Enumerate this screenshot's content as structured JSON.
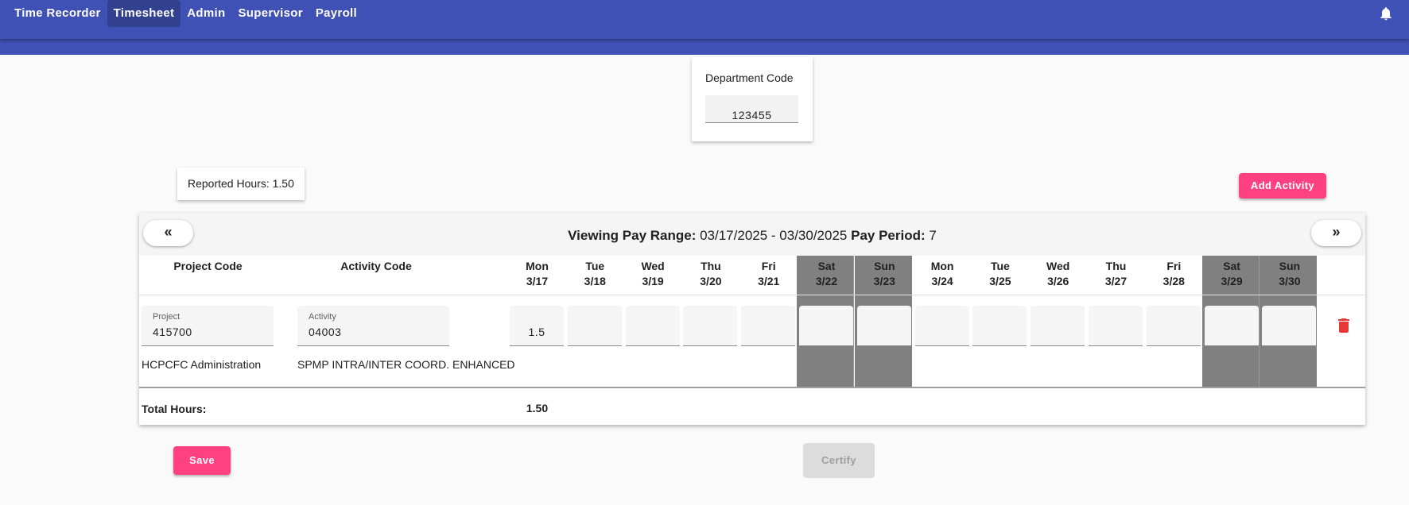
{
  "nav": {
    "items": [
      {
        "label": "Time Recorder",
        "active": false
      },
      {
        "label": "Timesheet",
        "active": true
      },
      {
        "label": "Admin",
        "active": false
      },
      {
        "label": "Supervisor",
        "active": false
      },
      {
        "label": "Payroll",
        "active": false
      }
    ],
    "notification_icon": "bell-icon"
  },
  "department": {
    "label": "Department Code",
    "value": "123455"
  },
  "reported_hours": {
    "text": "Reported Hours: 1.50"
  },
  "add_activity_label": "Add Activity",
  "pay_range": {
    "range_label": "Viewing Pay Range:",
    "range_value": " 03/17/2025 - 03/30/2025 ",
    "period_label": "Pay Period:",
    "period_value": " 7",
    "prev_label": "«",
    "next_label": "»"
  },
  "table": {
    "project_header": "Project Code",
    "activity_header": "Activity Code",
    "days": [
      {
        "day": "Mon",
        "date": "3/17",
        "weekend": false
      },
      {
        "day": "Tue",
        "date": "3/18",
        "weekend": false
      },
      {
        "day": "Wed",
        "date": "3/19",
        "weekend": false
      },
      {
        "day": "Thu",
        "date": "3/20",
        "weekend": false
      },
      {
        "day": "Fri",
        "date": "3/21",
        "weekend": false
      },
      {
        "day": "Sat",
        "date": "3/22",
        "weekend": true
      },
      {
        "day": "Sun",
        "date": "3/23",
        "weekend": true
      },
      {
        "day": "Mon",
        "date": "3/24",
        "weekend": false
      },
      {
        "day": "Tue",
        "date": "3/25",
        "weekend": false
      },
      {
        "day": "Wed",
        "date": "3/26",
        "weekend": false
      },
      {
        "day": "Thu",
        "date": "3/27",
        "weekend": false
      },
      {
        "day": "Fri",
        "date": "3/28",
        "weekend": false
      },
      {
        "day": "Sat",
        "date": "3/29",
        "weekend": true
      },
      {
        "day": "Sun",
        "date": "3/30",
        "weekend": true
      }
    ],
    "row": {
      "project_label": "Project",
      "project_value": "415700",
      "activity_label": "Activity",
      "activity_value": "04003",
      "project_desc": "HCPCFC Administration",
      "activity_desc": "SPMP INTRA/INTER COORD. ENHANCED",
      "hours": [
        "1.5",
        "",
        "",
        "",
        "",
        "",
        "",
        "",
        "",
        "",
        "",
        "",
        "",
        ""
      ],
      "delete_icon": "trash-icon"
    },
    "total_label": "Total Hours:",
    "totals": [
      "1.50",
      "",
      "",
      "",
      "",
      "",
      "",
      "",
      "",
      "",
      "",
      "",
      "",
      ""
    ]
  },
  "save_label": "Save",
  "certify_label": "Certify",
  "colors": {
    "app_bar": "#3f51b5",
    "accent": "#ff4081",
    "weekend_shade": "#808080",
    "delete_red": "#e53935"
  }
}
